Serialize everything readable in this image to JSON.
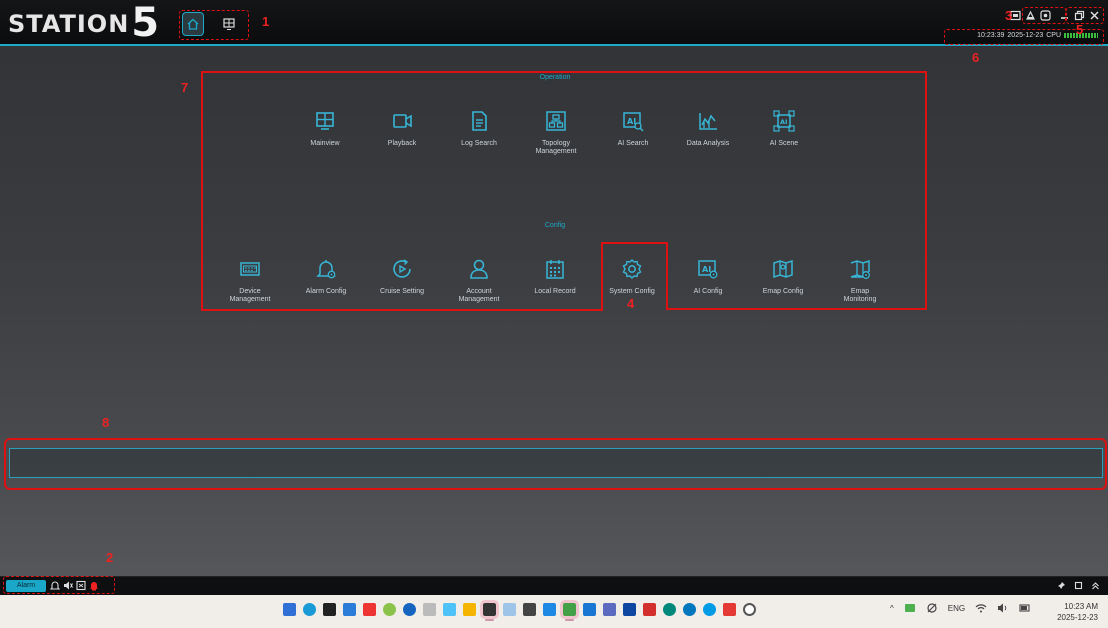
{
  "app": {
    "logo_text": "STATION",
    "logo_number": "5"
  },
  "status": {
    "time": "10:23:39",
    "date": "2025-12-23",
    "cpu_label": "CPU"
  },
  "sections": {
    "operation_title": "Operation",
    "config_title": "Config"
  },
  "operation_items": [
    {
      "label": "Mainview",
      "icon": "mainview-icon"
    },
    {
      "label": "Playback",
      "icon": "playback-icon"
    },
    {
      "label": "Log Search",
      "icon": "log-search-icon"
    },
    {
      "label": "Topology\nManagement",
      "icon": "topology-icon"
    },
    {
      "label": "AI Search",
      "icon": "ai-search-icon"
    },
    {
      "label": "Data Analysis",
      "icon": "data-analysis-icon"
    },
    {
      "label": "AI Scene",
      "icon": "ai-scene-icon"
    }
  ],
  "config_items": [
    {
      "label": "Device\nManagement",
      "icon": "device-icon"
    },
    {
      "label": "Alarm Config",
      "icon": "alarm-config-icon"
    },
    {
      "label": "Cruise Setting",
      "icon": "cruise-icon"
    },
    {
      "label": "Account\nManagement",
      "icon": "account-icon"
    },
    {
      "label": "Local Record",
      "icon": "calendar-icon"
    },
    {
      "label": "System Config",
      "icon": "gear-icon"
    },
    {
      "label": "AI Config",
      "icon": "ai-config-icon"
    },
    {
      "label": "Emap Config",
      "icon": "map-icon"
    },
    {
      "label": "Emap\nMonitoring",
      "icon": "map-monitor-icon"
    }
  ],
  "annotations": {
    "m1": "1",
    "m2": "2",
    "m3": "3",
    "m4": "4",
    "m5": "5",
    "m6": "6",
    "m7": "7",
    "m8": "8"
  },
  "bottom": {
    "alarm_tab": "Alarm"
  },
  "taskbar": {
    "lang": "ENG",
    "clock_time": "10:23 AM",
    "clock_date": "2025-12-23"
  },
  "colors": {
    "accent": "#1fa9c9",
    "annotation_red": "#dd1111"
  }
}
